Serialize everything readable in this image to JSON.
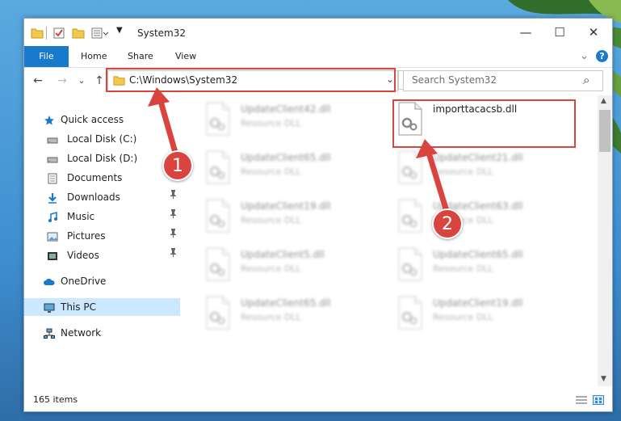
{
  "window": {
    "title": "System32",
    "min_glyph": "—",
    "max_glyph": "☐",
    "close_glyph": "✕"
  },
  "ribbon": {
    "tabs": [
      "File",
      "Home",
      "Share",
      "View"
    ],
    "expand_glyph": "⌄",
    "help_glyph": "?"
  },
  "nav": {
    "back_glyph": "←",
    "forward_glyph": "→",
    "recent_glyph": "⌄",
    "up_glyph": "↑",
    "address": "C:\\Windows\\System32",
    "address_dropdown_glyph": "⌄",
    "refresh_glyph": "↻",
    "search_placeholder": "Search System32",
    "search_icon_glyph": "⌕"
  },
  "sidebar": {
    "items": [
      {
        "label": "Quick access",
        "icon": "star-icon",
        "pinned": false
      },
      {
        "label": "Local Disk (C:)",
        "icon": "drive-icon",
        "pinned": false
      },
      {
        "label": "Local Disk (D:)",
        "icon": "drive-icon",
        "pinned": false
      },
      {
        "label": "Documents",
        "icon": "documents-icon",
        "pinned": true
      },
      {
        "label": "Downloads",
        "icon": "downloads-icon",
        "pinned": true
      },
      {
        "label": "Music",
        "icon": "music-icon",
        "pinned": true
      },
      {
        "label": "Pictures",
        "icon": "pictures-icon",
        "pinned": true
      },
      {
        "label": "Videos",
        "icon": "videos-icon",
        "pinned": true
      },
      {
        "label": "OneDrive",
        "icon": "cloud-icon",
        "pinned": false
      },
      {
        "label": "This PC",
        "icon": "computer-icon",
        "pinned": false,
        "selected": true
      },
      {
        "label": "Network",
        "icon": "network-icon",
        "pinned": false
      }
    ],
    "pin_glyph": "📌"
  },
  "files": {
    "highlighted": {
      "name": "importtacacsb.dll",
      "type": ""
    },
    "left_column": [
      {
        "name": "UpdateClient42.dll",
        "type": "Resource DLL"
      },
      {
        "name": "UpdateClient65.dll",
        "type": "Resource DLL"
      },
      {
        "name": "UpdateClient19.dll",
        "type": "Resource DLL"
      },
      {
        "name": "UpdateClient5.dll",
        "type": "Resource DLL"
      },
      {
        "name": "UpdateClient65.dll",
        "type": "Resource DLL"
      }
    ],
    "right_column": [
      {
        "name": "UpdateClient21.dll",
        "type": "Resource DLL"
      },
      {
        "name": "UpdateClient63.dll",
        "type": "Resource DLL"
      },
      {
        "name": "UpdateClient65.dll",
        "type": "Resource DLL"
      },
      {
        "name": "UpdateClient19.dll",
        "type": "Resource DLL"
      }
    ]
  },
  "status": {
    "item_count": "165 items"
  },
  "annotations": {
    "step1": "1",
    "step2": "2",
    "color": "#d9443f"
  }
}
